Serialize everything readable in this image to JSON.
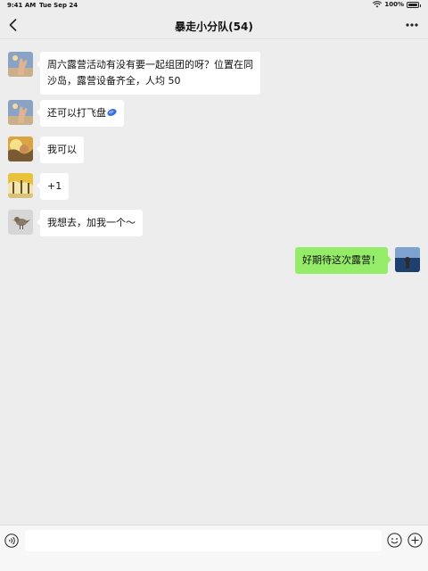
{
  "status_bar": {
    "time": "9:41 AM",
    "date": "Tue Sep 24",
    "battery": "100%"
  },
  "nav": {
    "title": "暴走小分队(54)"
  },
  "messages": [
    {
      "direction": "in",
      "avatar": "avatar-hand",
      "lines": [
        "周六露营活动有没有要一起组团的呀？位置在同",
        "沙岛，露营设备齐全，人均 50"
      ]
    },
    {
      "direction": "in",
      "avatar": "avatar-hand",
      "text": "还可以打飞盘"
    },
    {
      "direction": "in",
      "avatar": "avatar-sunset",
      "text": "我可以"
    },
    {
      "direction": "in",
      "avatar": "avatar-trees",
      "text": "+1"
    },
    {
      "direction": "in",
      "avatar": "avatar-bird",
      "text": "我想去，加我一个～"
    },
    {
      "direction": "out",
      "avatar": "avatar-sea",
      "text": "好期待这次露营！"
    }
  ],
  "input": {
    "value": "",
    "placeholder": ""
  },
  "colors": {
    "background": "#ededed",
    "incoming_bubble": "#ffffff",
    "outgoing_bubble": "#95ec69"
  }
}
